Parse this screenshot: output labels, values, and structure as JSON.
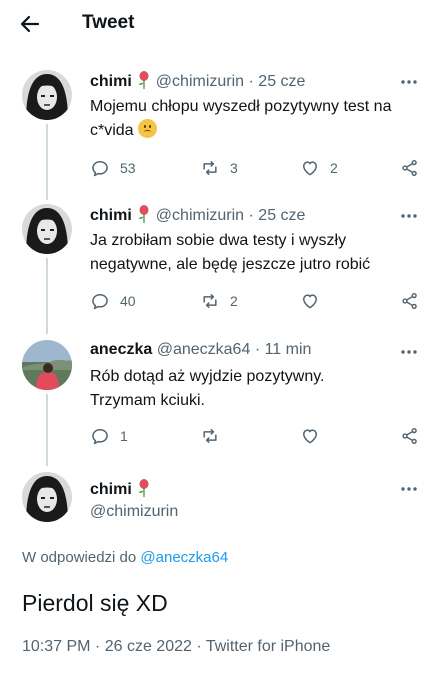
{
  "header": {
    "title": "Tweet"
  },
  "tweets": [
    {
      "name": "chimi",
      "handle": "@chimizurin",
      "time": "· 25 cze",
      "text1": "Mojemu chłopu wyszedł pozytywny test na",
      "text2": "c*vida",
      "emoji": "slightly-frowning-face",
      "replies": "53",
      "retweets": "3",
      "likes": "2"
    },
    {
      "name": "chimi",
      "handle": "@chimizurin",
      "time": "· 25 cze",
      "text1": "Ja zrobiłam sobie dwa testy i wyszły",
      "text2": "negatywne, ale będę jeszcze jutro robić",
      "replies": "40",
      "retweets": "2",
      "likes": ""
    },
    {
      "name": "aneczka",
      "handle": "@aneczka64",
      "time": "· 11 min",
      "text1": "Rób dotąd aż wyjdzie pozytywny.",
      "text2": "Trzymam kciuki.",
      "replies": "1",
      "retweets": "",
      "likes": ""
    }
  ],
  "main": {
    "name": "chimi",
    "handle": "@chimizurin",
    "reply_prefix": "W odpowiedzi do",
    "reply_to": "@aneczka64",
    "text": "Pierdol się XD",
    "meta": "10:37 PM · 26 cze 2022 · Twitter for iPhone"
  },
  "colors": {
    "accent": "#1d9bf0",
    "secondary_text": "#536471",
    "divider": "#eff3f4"
  }
}
